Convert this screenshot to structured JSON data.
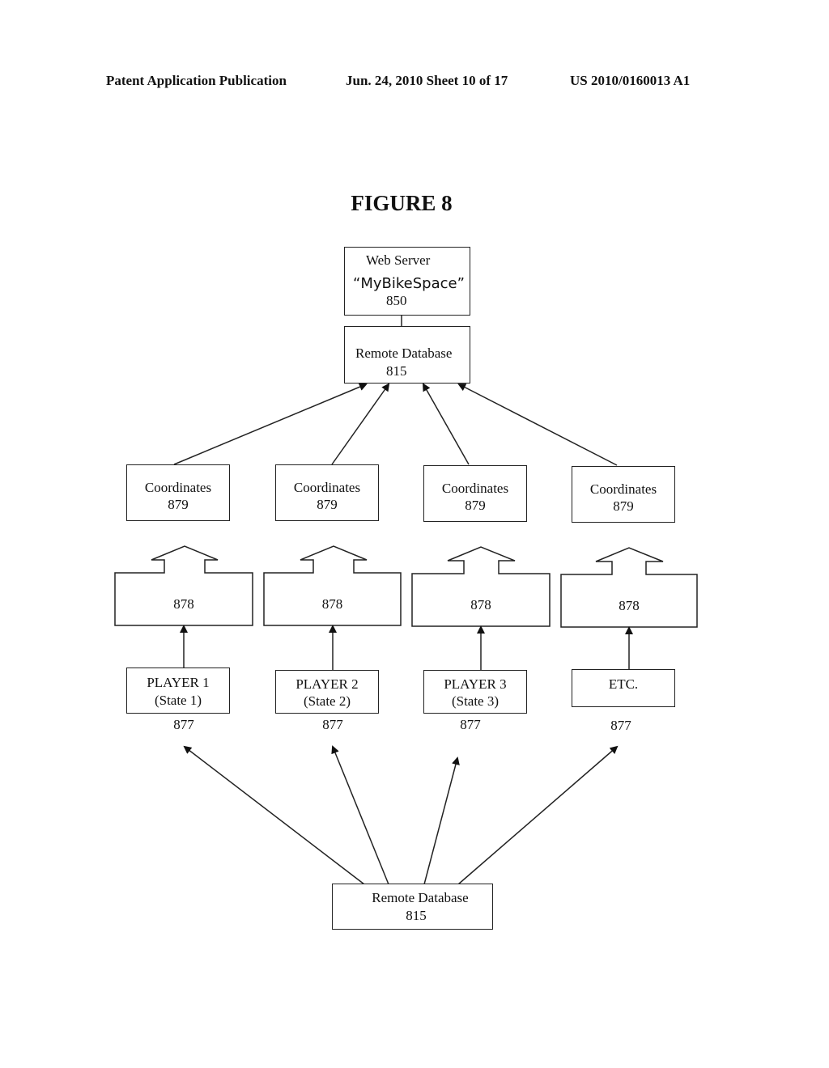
{
  "header": {
    "left": "Patent Application Publication",
    "center": "Jun. 24, 2010  Sheet 10 of 17",
    "right": "US 2010/0160013 A1"
  },
  "figure": {
    "title": "FIGURE 8",
    "web_server": {
      "line1": "Web Server",
      "line2": "“MyBikeSpace”",
      "ref": "850"
    },
    "remote_db_top": {
      "label": "Remote Database",
      "ref": "815"
    },
    "coordinates": [
      {
        "label": "Coordinates",
        "ref": "879"
      },
      {
        "label": "Coordinates",
        "ref": "879"
      },
      {
        "label": "Coordinates",
        "ref": "879"
      },
      {
        "label": "Coordinates",
        "ref": "879"
      }
    ],
    "transmitters": [
      {
        "ref": "878"
      },
      {
        "ref": "878"
      },
      {
        "ref": "878"
      },
      {
        "ref": "878"
      }
    ],
    "players": [
      {
        "line1": "PLAYER 1",
        "line2": "(State 1)",
        "ref": "877"
      },
      {
        "line1": "PLAYER 2",
        "line2": "(State 2)",
        "ref": "877"
      },
      {
        "line1": "PLAYER 3",
        "line2": "(State 3)",
        "ref": "877"
      },
      {
        "line1": "ETC.",
        "line2": "",
        "ref": "877"
      }
    ],
    "remote_db_bottom": {
      "label": "Remote Database",
      "ref": "815"
    }
  }
}
